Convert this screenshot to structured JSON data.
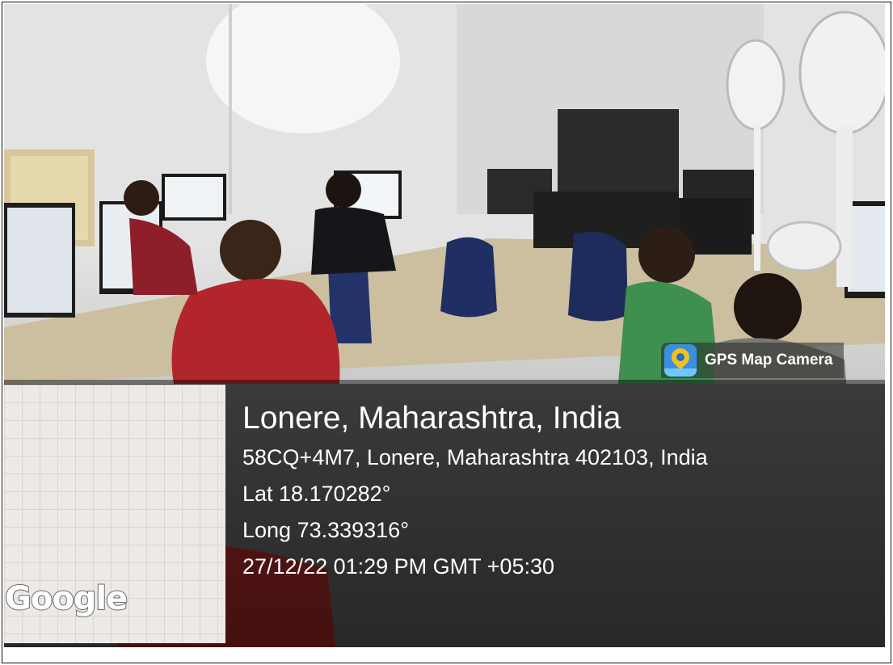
{
  "photo": {
    "scene": "students-at-computer-lab",
    "overlay_color": "#000000"
  },
  "badge": {
    "icon": "gps-map-camera-icon",
    "label": "GPS Map Camera"
  },
  "map_thumbnail": {
    "logo_text": "Google"
  },
  "location": {
    "title": "Lonere, Maharashtra, India",
    "address": "58CQ+4M7, Lonere, Maharashtra 402103, India",
    "latitude": "Lat 18.170282°",
    "longitude": "Long 73.339316°",
    "datetime": "27/12/22 01:29 PM GMT +05:30"
  }
}
